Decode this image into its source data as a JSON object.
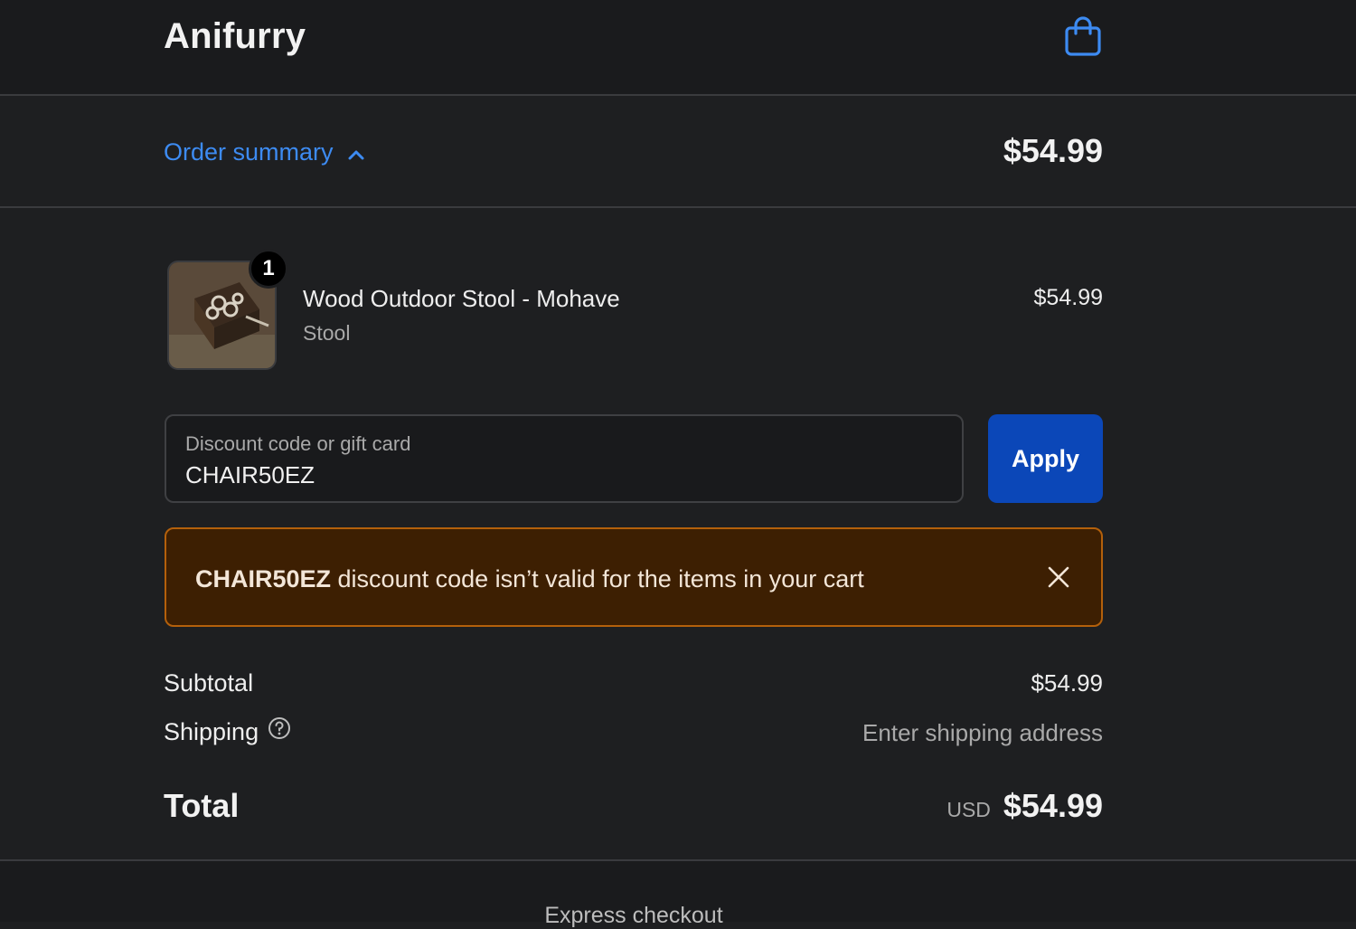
{
  "header": {
    "brand": "Anifurry",
    "cart_icon": "shopping-bag-icon"
  },
  "summary": {
    "toggle_label": "Order summary",
    "toggle_icon": "chevron-up-icon",
    "total": "$54.99"
  },
  "product": {
    "quantity": "1",
    "name": "Wood Outdoor Stool - Mohave",
    "variant": "Stool",
    "price": "$54.99"
  },
  "discount": {
    "label": "Discount code or gift card",
    "value": "CHAIR50EZ",
    "apply_label": "Apply"
  },
  "error": {
    "code": "CHAIR50EZ",
    "message": " discount code isn’t valid for the items in your cart",
    "close_icon": "close-icon"
  },
  "totals": {
    "subtotal_label": "Subtotal",
    "subtotal_value": "$54.99",
    "shipping_label": "Shipping",
    "shipping_value": "Enter shipping address",
    "total_label": "Total",
    "currency": "USD",
    "total_value": "$54.99"
  },
  "express": {
    "label": "Express checkout"
  },
  "colors": {
    "accent_link": "#3d8bf2",
    "primary_button": "#0b47b8",
    "warning_bg": "#3d1f02",
    "warning_border": "#b4600b"
  }
}
